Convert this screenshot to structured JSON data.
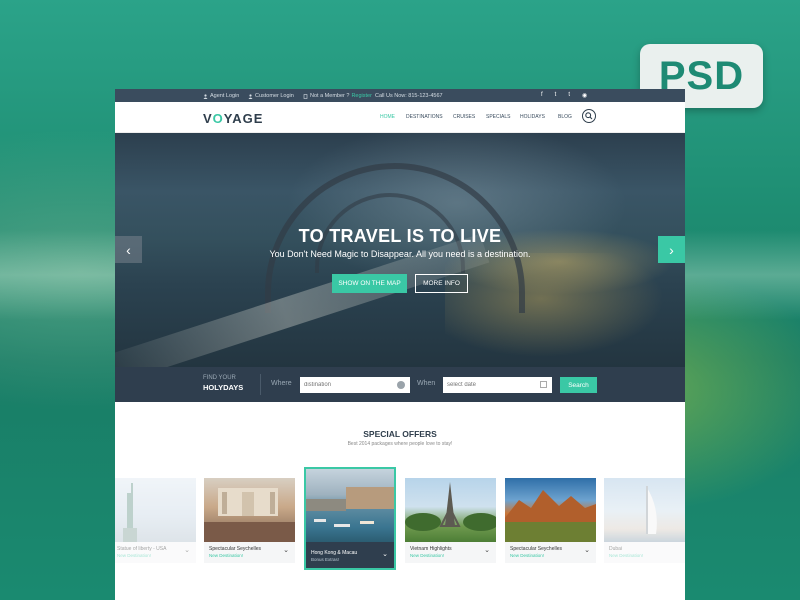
{
  "badge": {
    "label": "PSD"
  },
  "topbar": {
    "agent_login": "Agent Login",
    "customer_login": "Customer Login",
    "not_member": "Not a Member ?",
    "register": "Register",
    "call_us": "Call Us Now: 815-123-4567",
    "social": [
      "f",
      "t",
      "t",
      "◉"
    ]
  },
  "brand": {
    "logo_prefix": "V",
    "logo_o": "O",
    "logo_suffix": "YAGE"
  },
  "nav": {
    "items": [
      "HOME",
      "DESTINATIONS",
      "CRUISES",
      "SPECIALS",
      "HOLIDAYS",
      "BLOG"
    ],
    "active": "HOME"
  },
  "hero": {
    "title": "TO TRAVEL IS TO LIVE",
    "subtitle": "You Don't Need Magic to Disappear. All you need is a destination.",
    "btn_map": "SHOW ON THE MAP",
    "btn_info": "MORE INFO",
    "arrow_left": "‹",
    "arrow_right": "›"
  },
  "search": {
    "find_line1": "FIND YOUR",
    "find_line2": "HOLYDAYS",
    "where_label": "Where",
    "where_placeholder": "distination",
    "when_label": "When",
    "when_placeholder": "select date",
    "button": "Search"
  },
  "offers": {
    "title": "SPECIAL OFFERS",
    "subtitle": "Best 2014 packages where people love to stay!",
    "cards": [
      {
        "title": "Statue of liberty - USA",
        "note": "New Destination!"
      },
      {
        "title": "Spectacular Seychelles",
        "note": "New Destination!"
      },
      {
        "title": "Hong Kong & Macau",
        "note": "Bonus Extras!"
      },
      {
        "title": "Vietnam Highlights",
        "note": "New Destination!"
      },
      {
        "title": "Spectacular Seychelles",
        "note": "New Destination!"
      },
      {
        "title": "Dubai",
        "note": "New Destination!"
      }
    ]
  },
  "colors": {
    "accent": "#3ac8a5",
    "dark": "#2f3e4e",
    "background": "#1f8a72"
  }
}
